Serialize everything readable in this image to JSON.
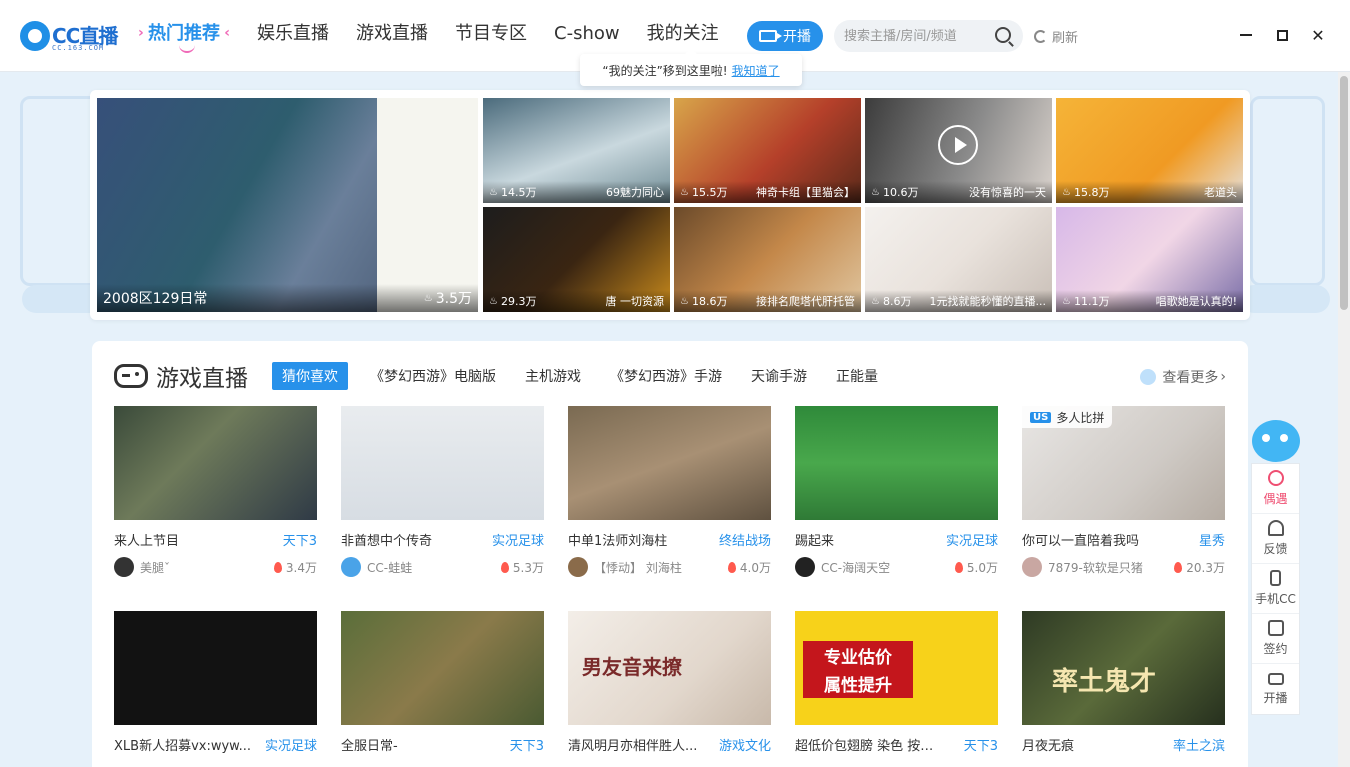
{
  "header": {
    "logo_text": "CC直播",
    "logo_sub": "CC.163.COM",
    "nav": [
      {
        "label": "热门推荐",
        "active": true
      },
      {
        "label": "娱乐直播"
      },
      {
        "label": "游戏直播"
      },
      {
        "label": "节目专区"
      },
      {
        "label": "C-show"
      },
      {
        "label": "我的关注"
      }
    ],
    "live_button": "开播",
    "search_placeholder": "搜索主播/房间/频道",
    "refresh": "刷新",
    "tooltip_text": "“我的关注”移到这里啦!",
    "tooltip_link": "我知道了"
  },
  "banner": {
    "main": {
      "title": "2008区129日常",
      "views": "3.5万"
    },
    "tiles": [
      {
        "views": "14.5万",
        "title": "69魅力同心"
      },
      {
        "views": "15.5万",
        "title": "神奇卡组【里猫会】"
      },
      {
        "views": "10.6万",
        "title": "没有惊喜的一天"
      },
      {
        "views": "15.8万",
        "title": "老道头"
      },
      {
        "views": "29.3万",
        "title": "唐 一切资源"
      },
      {
        "views": "18.6万",
        "title": "接排名爬塔代肝托管"
      },
      {
        "views": "8.6万",
        "title": "1元找就能秒懂的直播..."
      },
      {
        "views": "11.1万",
        "title": "唱歌她是认真的!"
      }
    ]
  },
  "game_section": {
    "title": "游戏直播",
    "tabs": [
      "猜你喜欢",
      "《梦幻西游》电脑版",
      "主机游戏",
      "《梦幻西游》手游",
      "天谕手游",
      "正能量"
    ],
    "more": "查看更多",
    "cards": [
      {
        "title": "来人上节目",
        "category": "天下3",
        "anchor": "美腿ˇ",
        "hot": "3.4万"
      },
      {
        "title": "非酋想中个传奇",
        "category": "实况足球",
        "anchor": "CC-蛙蛙",
        "hot": "5.3万"
      },
      {
        "title": "中单1法师刘海柱",
        "category": "终结战场",
        "anchor": "【悸动】 刘海柱",
        "hot": "4.0万"
      },
      {
        "title": "踢起来",
        "category": "实况足球",
        "anchor": "CC-海阔天空",
        "hot": "5.0万"
      },
      {
        "title": "你可以一直陪着我吗",
        "category": "星秀",
        "anchor": "7879-软软是只猪",
        "hot": "20.3万",
        "badge": "多人比拼",
        "badge_tag": "US"
      },
      {
        "title": "XLB新人招募vx:wyw...",
        "category": "实况足球"
      },
      {
        "title": "全服日常-",
        "category": "天下3"
      },
      {
        "title": "清风明月亦相伴胜人...",
        "category": "游戏文化"
      },
      {
        "title": "超低价包翅膀 染色 按比...",
        "category": "天下3"
      },
      {
        "title": "月夜无痕",
        "category": "率土之滨"
      }
    ],
    "thumb_texts": [
      "男友音来撩",
      "专业估价",
      "属性提升",
      "率土鬼才"
    ]
  },
  "sidebar": [
    "偶遇",
    "反馈",
    "手机CC",
    "签约",
    "开播"
  ]
}
